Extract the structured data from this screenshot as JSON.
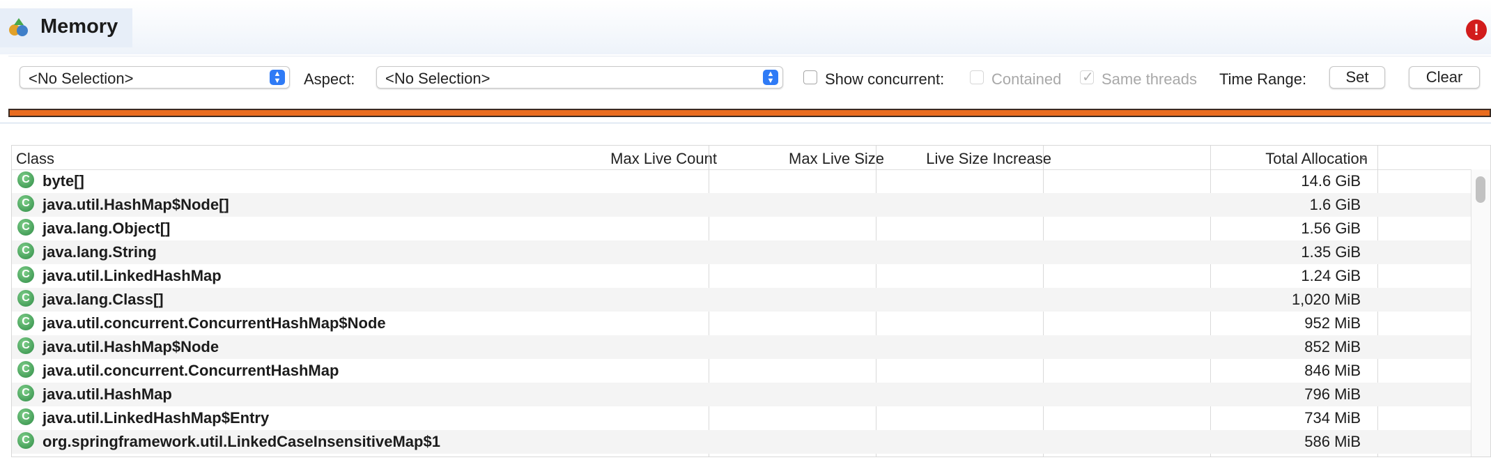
{
  "window": {
    "title": "Memory"
  },
  "toolbar": {
    "selector1": "<No Selection>",
    "aspect_label": "Aspect:",
    "aspect_value": "<No Selection>",
    "show_concurrent_label": "Show concurrent:",
    "contained_label": "Contained",
    "same_threads_label": "Same threads",
    "time_range_label": "Time Range:",
    "set_label": "Set",
    "clear_label": "Clear"
  },
  "table": {
    "columns": [
      "Class",
      "Max Live Count",
      "Max Live Size",
      "Live Size Increase",
      "Total Allocation"
    ],
    "sort_indicator": "⌄",
    "rows": [
      {
        "name": "byte[]",
        "total": "14.6 GiB"
      },
      {
        "name": "java.util.HashMap$Node[]",
        "total": "1.6 GiB"
      },
      {
        "name": "java.lang.Object[]",
        "total": "1.56 GiB"
      },
      {
        "name": "java.lang.String",
        "total": "1.35 GiB"
      },
      {
        "name": "java.util.LinkedHashMap",
        "total": "1.24 GiB"
      },
      {
        "name": "java.lang.Class[]",
        "total": "1,020 MiB"
      },
      {
        "name": "java.util.concurrent.ConcurrentHashMap$Node",
        "total": "952 MiB"
      },
      {
        "name": "java.util.HashMap$Node",
        "total": "852 MiB"
      },
      {
        "name": "java.util.concurrent.ConcurrentHashMap",
        "total": "846 MiB"
      },
      {
        "name": "java.util.HashMap",
        "total": "796 MiB"
      },
      {
        "name": "java.util.LinkedHashMap$Entry",
        "total": "734 MiB"
      },
      {
        "name": "org.springframework.util.LinkedCaseInsensitiveMap$1",
        "total": "586 MiB"
      }
    ]
  },
  "icons": {
    "class_icon": "C",
    "error_icon": "!",
    "stepper_icon": "▲▼",
    "check_icon": "✓"
  },
  "colors": {
    "range_bar": "#e96c1f",
    "accent": "#2f7bf6",
    "error": "#d21c1c"
  }
}
